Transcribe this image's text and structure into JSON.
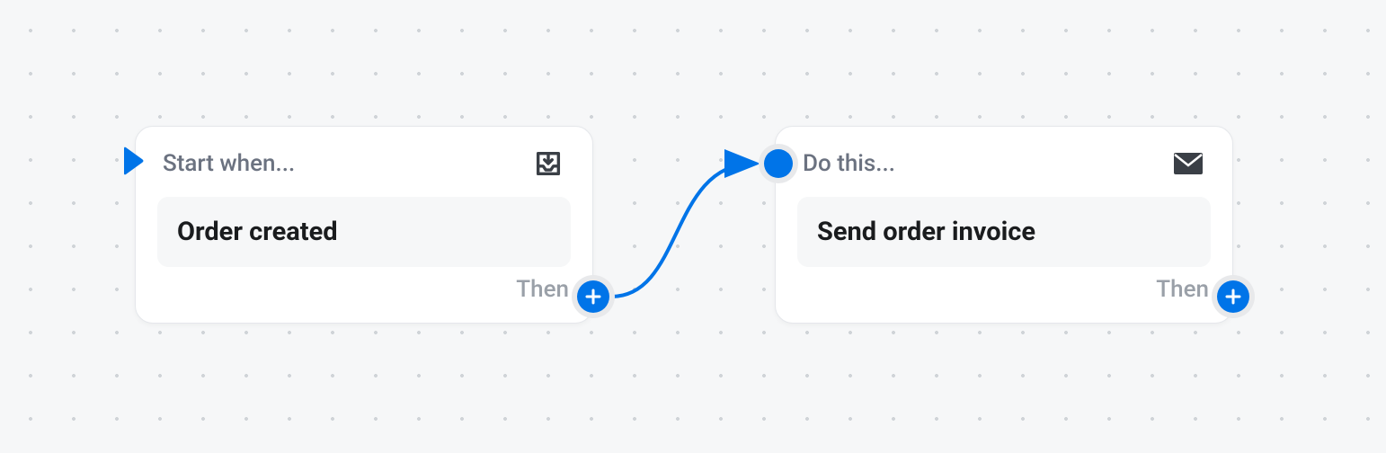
{
  "nodes": {
    "trigger": {
      "header_label": "Start when...",
      "content": "Order created",
      "then_label": "Then"
    },
    "action": {
      "header_label": "Do this...",
      "content": "Send order invoice",
      "then_label": "Then"
    }
  },
  "colors": {
    "accent": "#0074E8"
  }
}
